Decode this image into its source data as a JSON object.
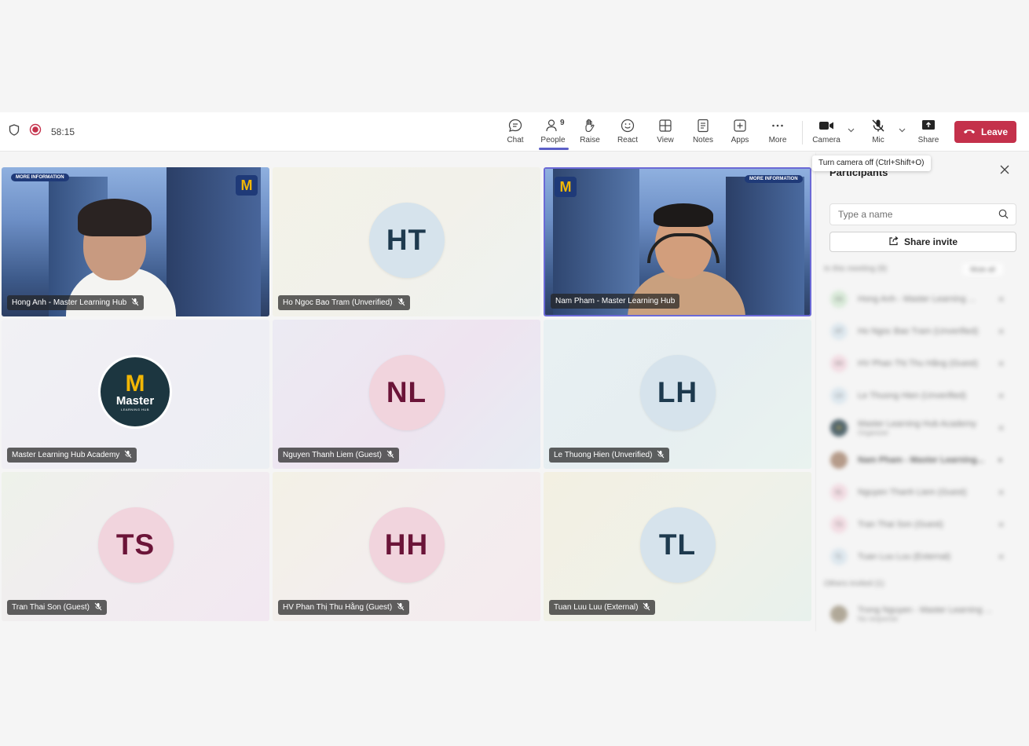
{
  "toolbar": {
    "timer": "58:15",
    "buttons": {
      "chat": "Chat",
      "people": "People",
      "people_count": "9",
      "raise": "Raise",
      "react": "React",
      "view": "View",
      "notes": "Notes",
      "apps": "Apps",
      "more": "More",
      "camera": "Camera",
      "mic": "Mic",
      "share": "Share"
    },
    "leave": "Leave",
    "tooltip": "Turn camera off (Ctrl+Shift+O)"
  },
  "tiles": [
    {
      "name": "Hong Anh - Master Learning Hub",
      "initials": "",
      "type": "video"
    },
    {
      "name": "Ho Ngoc Bao Tram (Unverified)",
      "initials": "HT",
      "type": "avatar"
    },
    {
      "name": "Nam Pham - Master Learning Hub",
      "initials": "",
      "type": "video"
    },
    {
      "name": "Master Learning Hub Academy",
      "initials": "",
      "type": "logo"
    },
    {
      "name": "Nguyen Thanh Liem (Guest)",
      "initials": "NL",
      "type": "avatar"
    },
    {
      "name": "Le Thuong Hien (Unverified)",
      "initials": "LH",
      "type": "avatar"
    },
    {
      "name": "Tran Thai Son (Guest)",
      "initials": "TS",
      "type": "avatar"
    },
    {
      "name": "HV Phan Thị Thu Hằng (Guest)",
      "initials": "HH",
      "type": "avatar"
    },
    {
      "name": "Tuan Luu Luu (External)",
      "initials": "TL",
      "type": "avatar"
    }
  ],
  "logo": {
    "text": "Master",
    "letter": "M",
    "sub": "LEARNING HUB"
  },
  "video_badges": {
    "more_information": "MORE INFORMATION"
  },
  "panel": {
    "title": "Participants",
    "search_placeholder": "Type a name",
    "share_invite": "Share invite",
    "in_meeting": "In this meeting (9)",
    "mute_all": "Mute all",
    "others_invited": "Others invited (1)",
    "participants": [
      {
        "name": "Hong Anh - Master Learning ...",
        "initials": "HA"
      },
      {
        "name": "Ho Ngoc Bao Tram (Unverified)",
        "initials": "HT"
      },
      {
        "name": "HV Phan Thị Thu Hằng (Guest)",
        "initials": "HH"
      },
      {
        "name": "Le Thuong Hien (Unverified)",
        "initials": "LH"
      },
      {
        "name": "Master Learning Hub Academy",
        "initials": "M",
        "sub": "Organizer"
      },
      {
        "name": "Nam Pham - Master Learning...",
        "initials": ""
      },
      {
        "name": "Nguyen Thanh Liem (Guest)",
        "initials": "NL"
      },
      {
        "name": "Tran Thai Son (Guest)",
        "initials": "TS"
      },
      {
        "name": "Tuan Luu Luu (External)",
        "initials": "TL"
      }
    ],
    "invited": [
      {
        "name": "Trong Nguyen - Master Learning ...",
        "sub": "No response"
      }
    ]
  },
  "colors": {
    "accent": "#5b5fc7",
    "leave": "#c4314b",
    "avatar_blue_bg": "#d6e3ec",
    "avatar_blue_fg": "#1e3a4e",
    "avatar_pink_bg": "#f1d4dd",
    "avatar_pink_fg": "#6b1438"
  }
}
